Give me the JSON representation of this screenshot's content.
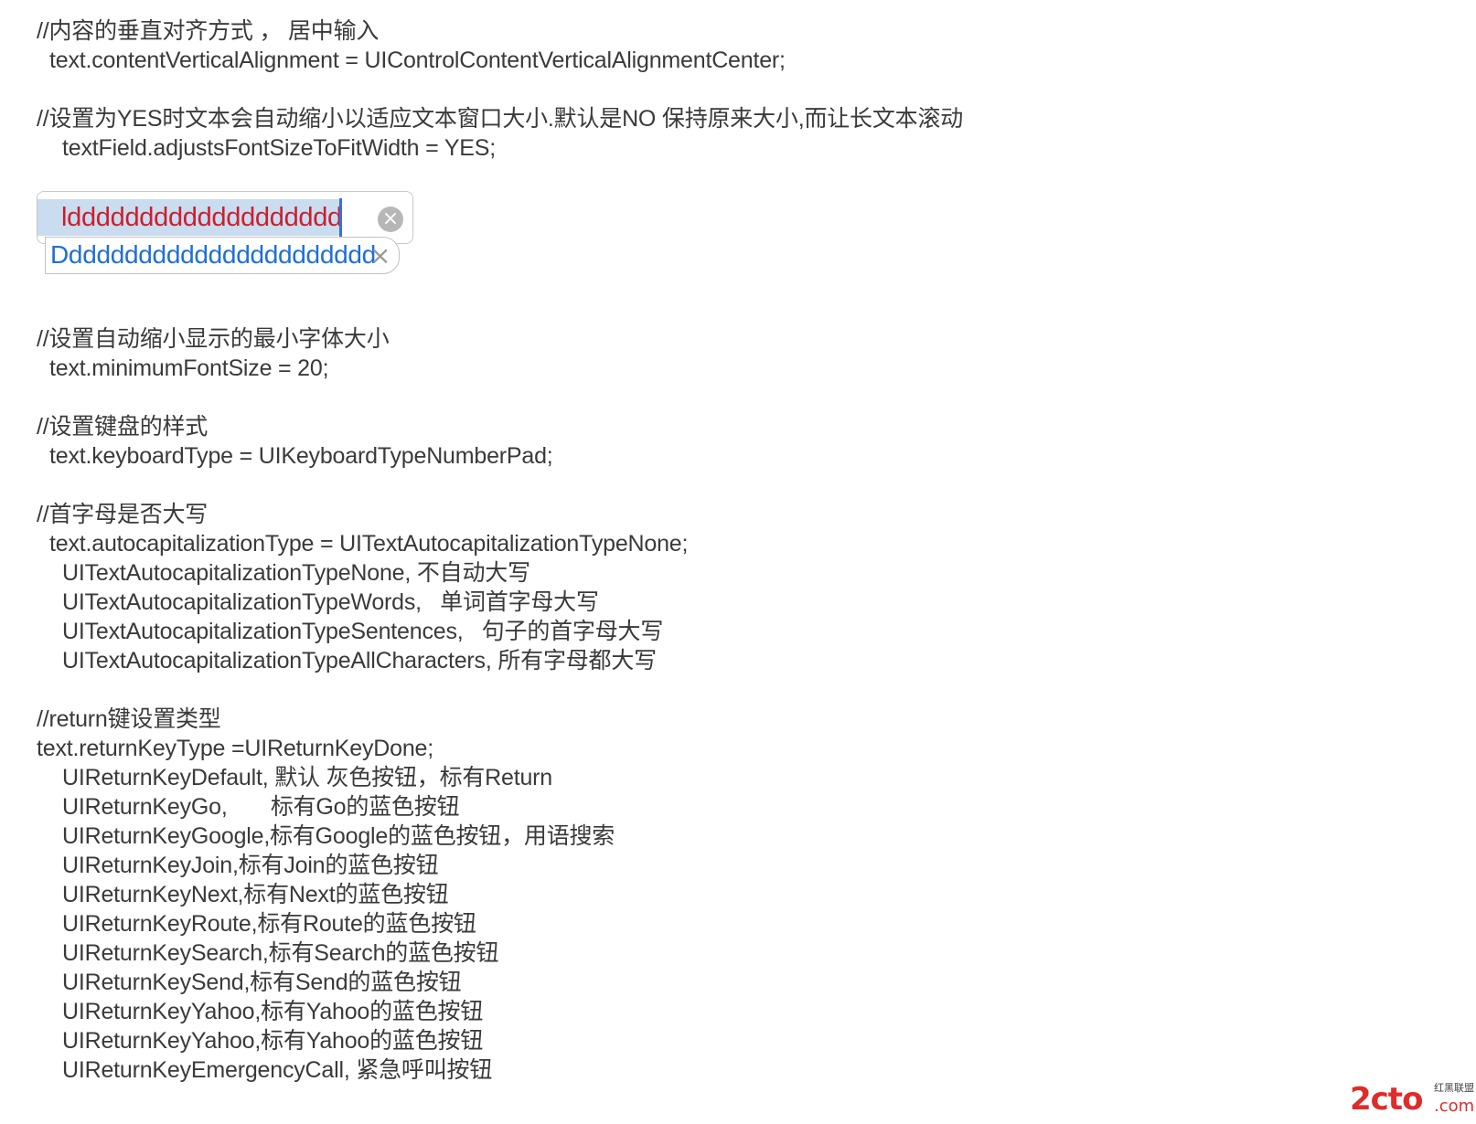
{
  "lines": {
    "l1": "//内容的垂直对齐方式 ， 居中输入",
    "l2": "text.contentVerticalAlignment = UIControlContentVerticalAlignmentCenter;",
    "l3": "//设置为YES时文本会自动缩小以适应文本窗口大小.默认是NO 保持原来大小,而让长文本滚动",
    "l4": "textField.adjustsFontSizeToFitWidth = YES;",
    "l5": "//设置自动缩小显示的最小字体大小",
    "l6": "text.minimumFontSize = 20;",
    "l7": "//设置键盘的样式",
    "l8": "text.keyboardType = UIKeyboardTypeNumberPad;",
    "l9": "//首字母是否大写",
    "l10": "text.autocapitalizationType = UITextAutocapitalizationTypeNone;",
    "l11": "UITextAutocapitalizationTypeNone, 不自动大写",
    "l12": "UITextAutocapitalizationTypeWords,   单词首字母大写",
    "l13": "UITextAutocapitalizationTypeSentences,   句子的首字母大写",
    "l14": "UITextAutocapitalizationTypeAllCharacters, 所有字母都大写",
    "l15": "//return键设置类型",
    "l16": "text.returnKeyType =UIReturnKeyDone;",
    "l17": "UIReturnKeyDefault, 默认 灰色按钮，标有Return",
    "l18": "UIReturnKeyGo,       标有Go的蓝色按钮",
    "l19": "UIReturnKeyGoogle,标有Google的蓝色按钮，用语搜索",
    "l20": "UIReturnKeyJoin,标有Join的蓝色按钮",
    "l21": "UIReturnKeyNext,标有Next的蓝色按钮",
    "l22": "UIReturnKeyRoute,标有Route的蓝色按钮",
    "l23": "UIReturnKeySearch,标有Search的蓝色按钮",
    "l24": "UIReturnKeySend,标有Send的蓝色按钮",
    "l25": "UIReturnKeyYahoo,标有Yahoo的蓝色按钮",
    "l26": "UIReturnKeyYahoo,标有Yahoo的蓝色按钮",
    "l27": "UIReturnKeyEmergencyCall, 紧急呼叫按钮"
  },
  "demo": {
    "field1_text": "lddddddddddddddddddd",
    "field2_text": "Ddddddddddddddddddddddd",
    "clear_glyph": "×",
    "field1_color": "#cc1e2c",
    "field2_color": "#1f6fd6"
  },
  "watermark": {
    "main": "2cto",
    "com": ".com",
    "sub": "红黑联盟"
  }
}
